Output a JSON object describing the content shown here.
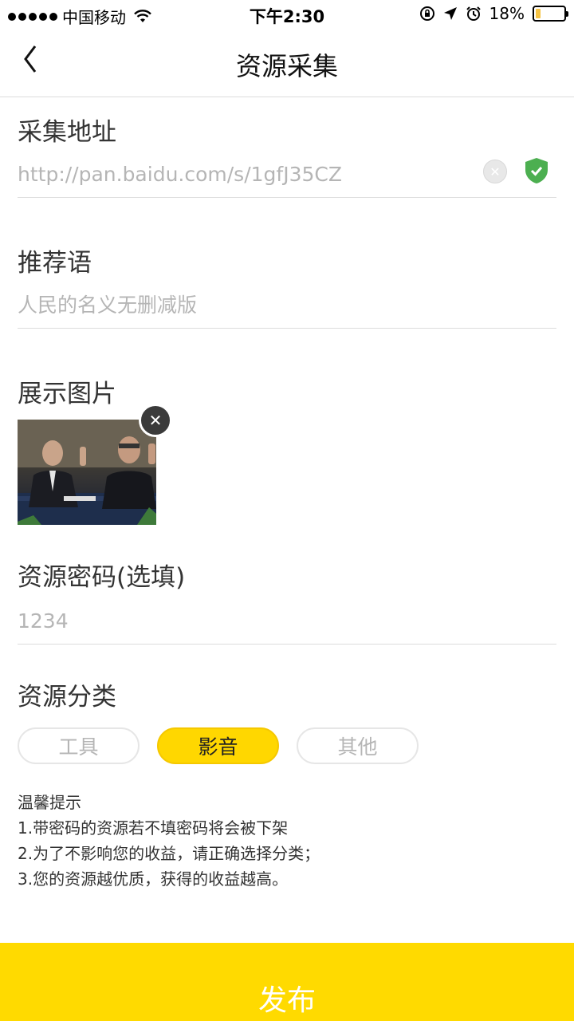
{
  "status_bar": {
    "carrier": "中国移动",
    "time": "下午2:30",
    "battery": "18%",
    "battery_level": 0.18
  },
  "nav": {
    "title": "资源采集"
  },
  "form": {
    "address": {
      "label": "采集地址",
      "value": "http://pan.baidu.com/s/1gfJ35CZ"
    },
    "recommend": {
      "label": "推荐语",
      "placeholder": "人民的名义无删减版"
    },
    "image": {
      "label": "展示图片"
    },
    "password": {
      "label": "资源密码(选填)",
      "placeholder": "1234"
    },
    "category": {
      "label": "资源分类",
      "options": [
        "工具",
        "影音",
        "其他"
      ],
      "selected": "影音"
    }
  },
  "tips": {
    "title": "温馨提示",
    "lines": [
      "1.带密码的资源若不填密码将会被下架",
      "2.为了不影响您的收益，请正确选择分类；",
      "3.您的资源越优质，获得的收益越高。"
    ]
  },
  "publish_label": "发布",
  "colors": {
    "accent": "#ffda00",
    "verified": "#4caf50"
  }
}
